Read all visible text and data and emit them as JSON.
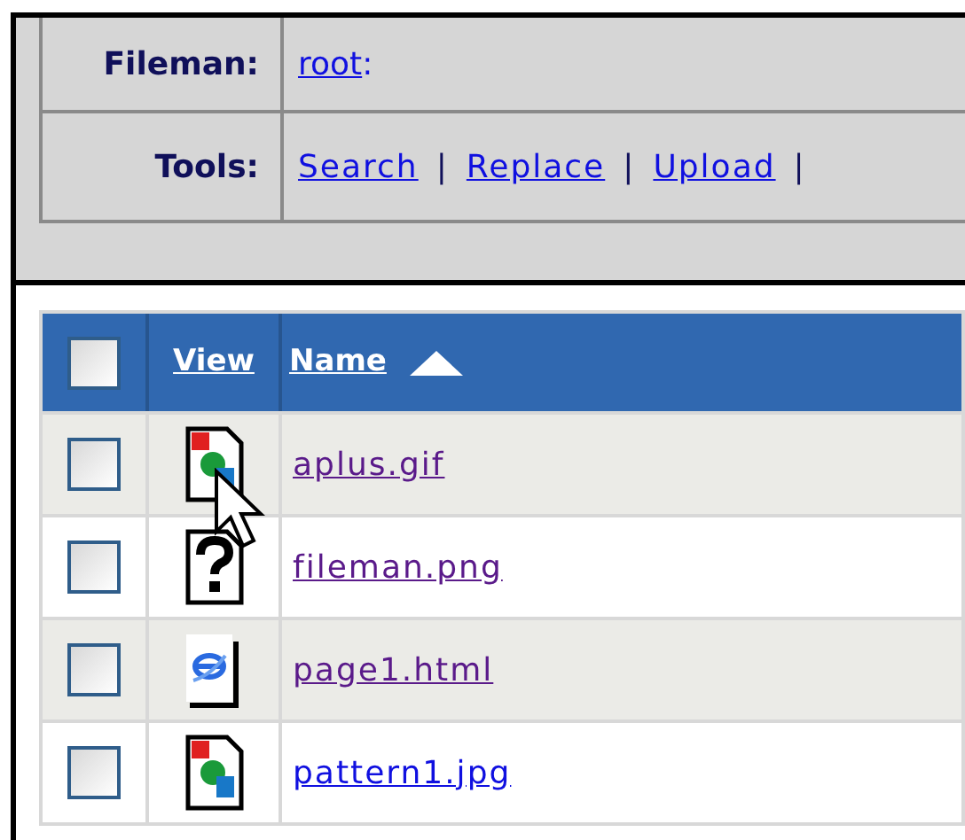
{
  "header": {
    "fileman_label": "Fileman:",
    "path": [
      {
        "text": "root",
        "kind": "link"
      },
      {
        "text": ":",
        "kind": "text"
      }
    ],
    "tools_label": "Tools:",
    "tools": [
      {
        "text": "Search",
        "kind": "link"
      },
      {
        "text": "|",
        "kind": "separator"
      },
      {
        "text": "Replace",
        "kind": "link"
      },
      {
        "text": "|",
        "kind": "separator"
      },
      {
        "text": "Upload",
        "kind": "link"
      },
      {
        "text": "|",
        "kind": "separator"
      }
    ]
  },
  "table": {
    "select_all": {
      "checked": false
    },
    "columns": [
      {
        "label": "View",
        "sorted": false
      },
      {
        "label": "Name",
        "sorted": true
      }
    ],
    "rows": [
      {
        "checked": false,
        "kind": "image",
        "name": "aplus.gif",
        "visited": true
      },
      {
        "checked": false,
        "kind": "unknown",
        "name": "fileman.png",
        "visited": true
      },
      {
        "checked": false,
        "kind": "html",
        "name": "page1.html",
        "visited": true
      },
      {
        "checked": false,
        "kind": "image",
        "name": "pattern1.jpg",
        "visited": false
      }
    ]
  }
}
